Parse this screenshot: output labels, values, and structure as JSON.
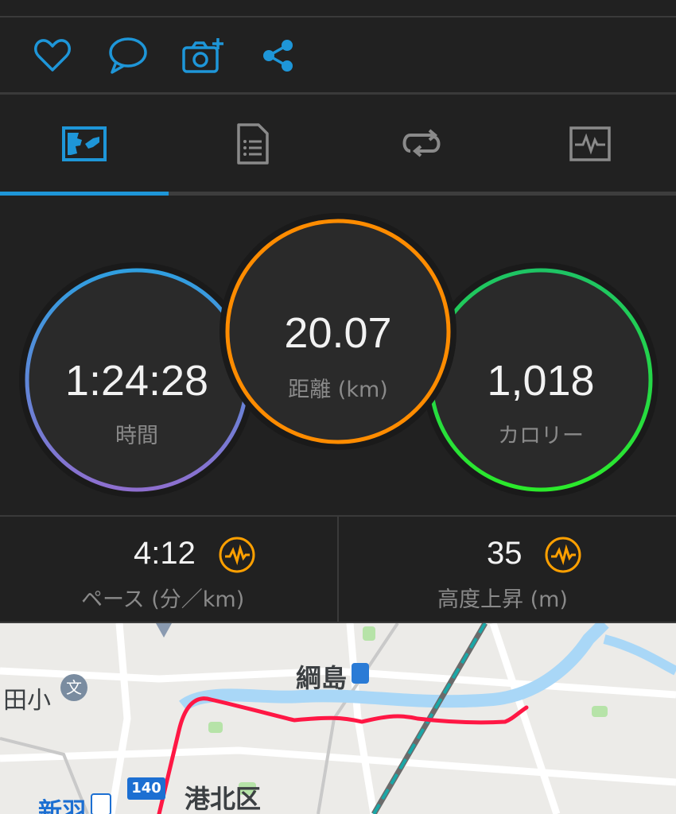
{
  "actions": [
    {
      "name": "like",
      "icon": "heart-icon"
    },
    {
      "name": "comment",
      "icon": "speech-bubble-icon"
    },
    {
      "name": "add-photo",
      "icon": "camera-plus-icon"
    },
    {
      "name": "share",
      "icon": "share-icon"
    }
  ],
  "tabs": [
    {
      "name": "map-tab",
      "icon": "map-icon",
      "active": true
    },
    {
      "name": "details-tab",
      "icon": "document-list-icon",
      "active": false
    },
    {
      "name": "laps-tab",
      "icon": "repeat-icon",
      "active": false
    },
    {
      "name": "charts-tab",
      "icon": "activity-chart-icon",
      "active": false
    }
  ],
  "stats": {
    "time": {
      "value": "1:24:28",
      "label": "時間"
    },
    "distance": {
      "value": "20.07",
      "label": "距離 (km)"
    },
    "calories": {
      "value": "1,018",
      "label": "カロリー"
    }
  },
  "metrics": {
    "pace": {
      "value": "4:12",
      "label": "ペース (分／km)",
      "icon": "activity-wave-icon"
    },
    "elevation": {
      "value": "35",
      "label": "高度上昇 (m)",
      "icon": "activity-wave-icon"
    }
  },
  "map": {
    "labels": {
      "station": "綱島",
      "school": "田小",
      "school_icon": "文",
      "ward": "港北区",
      "station2": "新羽",
      "route_number": "140"
    }
  },
  "colors": {
    "accent_blue": "#1e96d8",
    "time_ring_start": "#2f9fe0",
    "time_ring_end": "#8e6fcf",
    "distance_ring": "#ff8c00",
    "calories_ring": "#22d35a",
    "metric_icon": "#ffa000",
    "route": "#ff1744"
  }
}
